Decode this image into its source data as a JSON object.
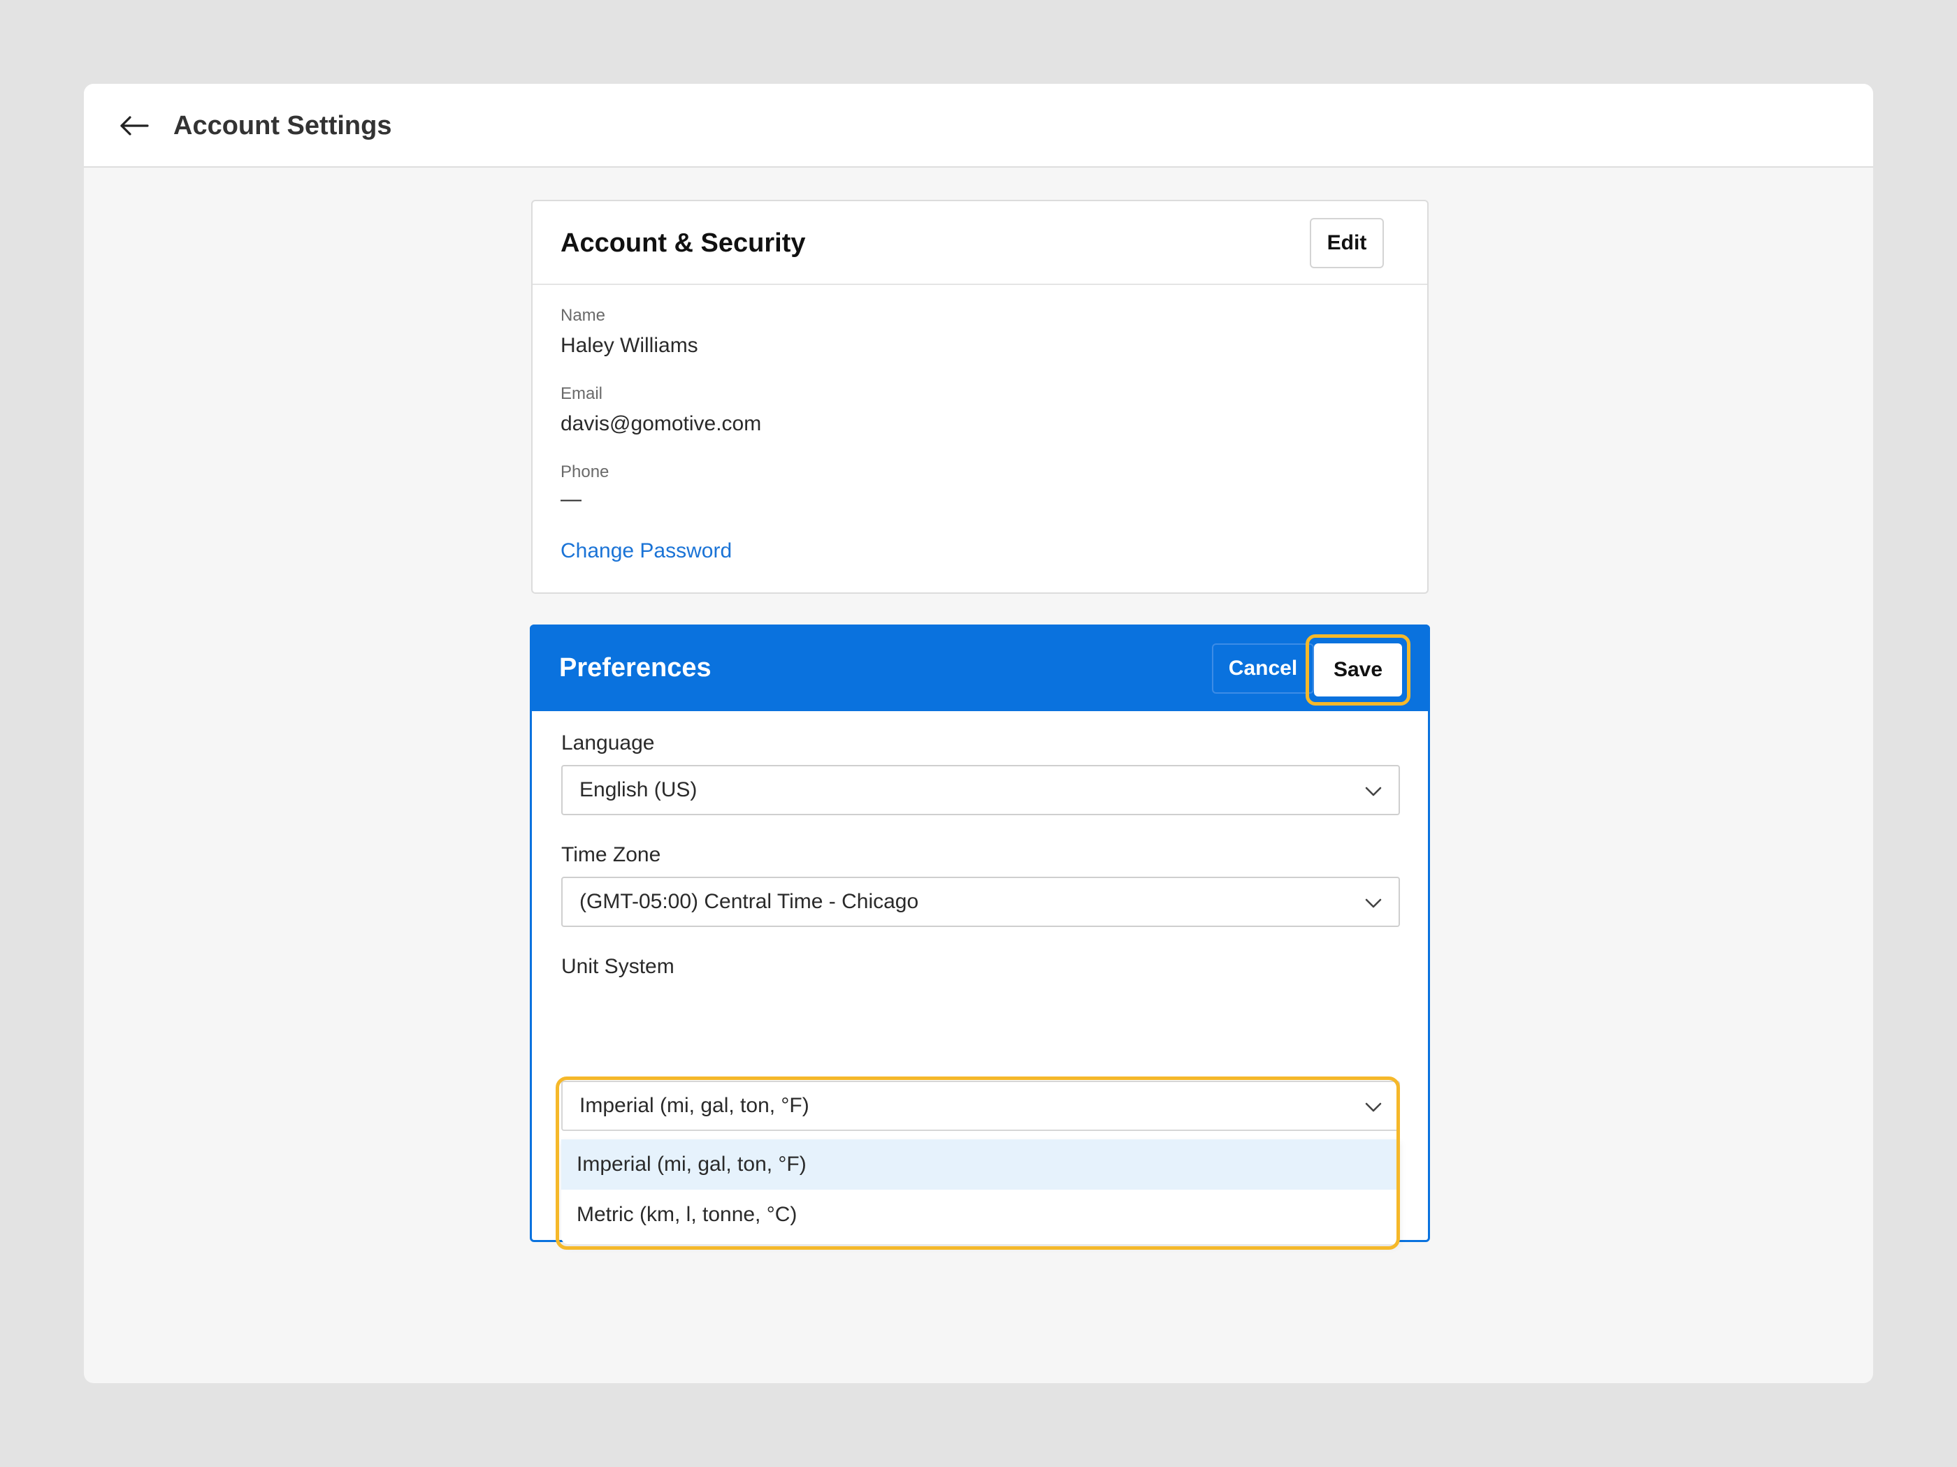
{
  "header": {
    "title": "Account Settings",
    "back_icon": "arrow-left-icon"
  },
  "account_card": {
    "title": "Account & Security",
    "edit_label": "Edit",
    "fields": [
      {
        "label": "Name",
        "value": "Haley Williams"
      },
      {
        "label": "Email",
        "value": "davis@gomotive.com"
      },
      {
        "label": "Phone",
        "value": "—"
      }
    ],
    "change_password_label": "Change Password"
  },
  "preferences_card": {
    "title": "Preferences",
    "cancel_label": "Cancel",
    "save_label": "Save",
    "language": {
      "label": "Language",
      "value": "English (US)"
    },
    "time_zone": {
      "label": "Time Zone",
      "value": "(GMT-05:00) Central Time - Chicago"
    },
    "unit_system": {
      "label": "Unit System",
      "value": "Imperial (mi, gal, ton, °F)",
      "options": [
        "Imperial (mi, gal, ton, °F)",
        "Metric (km, l, tonne, °C)"
      ],
      "selected_index": 0
    }
  },
  "colors": {
    "accent": "#0a72de",
    "highlight": "#f5b82a",
    "link": "#1a73d6",
    "option_selected_bg": "#e6f2fc"
  }
}
